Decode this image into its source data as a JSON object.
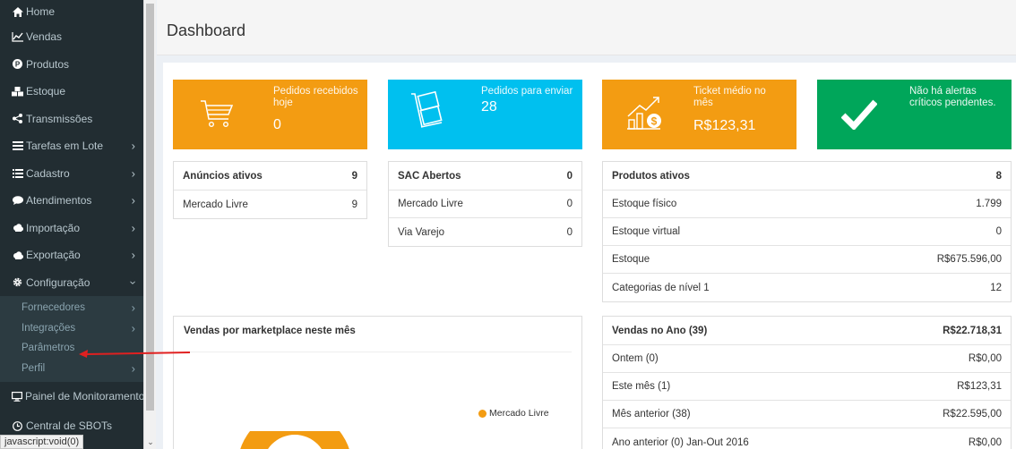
{
  "sidebar": {
    "items": [
      {
        "label": "Home"
      },
      {
        "label": "Vendas"
      },
      {
        "label": "Produtos"
      },
      {
        "label": "Estoque"
      },
      {
        "label": "Transmissões"
      },
      {
        "label": "Tarefas em Lote"
      },
      {
        "label": "Cadastro"
      },
      {
        "label": "Atendimentos"
      },
      {
        "label": "Importação"
      },
      {
        "label": "Exportação"
      },
      {
        "label": "Configuração"
      }
    ],
    "submenu": [
      {
        "label": "Fornecedores"
      },
      {
        "label": "Integrações"
      },
      {
        "label": "Parâmetros"
      },
      {
        "label": "Perfil"
      }
    ],
    "bottom_items": [
      {
        "label": "Painel de Monitoramento"
      },
      {
        "label": "Central de SBOTs"
      }
    ]
  },
  "status_bar": "javascript:void(0)",
  "header": {
    "title": "Dashboard"
  },
  "tiles": [
    {
      "label": "Pedidos recebidos hoje",
      "value": "0",
      "color": "#f39c12"
    },
    {
      "label": "Pedidos para enviar",
      "value": "28",
      "color": "#00c0ef"
    },
    {
      "label": "Ticket médio no mês",
      "value": "R$123,31",
      "color": "#f39c12"
    },
    {
      "label": "Não há alertas críticos pendentes.",
      "value": "",
      "color": "#00a65a"
    }
  ],
  "anuncios": {
    "title": "Anúncios ativos",
    "total": "9",
    "rows": [
      {
        "label": "Mercado Livre",
        "value": "9"
      }
    ]
  },
  "sac": {
    "title": "SAC Abertos",
    "total": "0",
    "rows": [
      {
        "label": "Mercado Livre",
        "value": "0"
      },
      {
        "label": "Via Varejo",
        "value": "0"
      }
    ]
  },
  "produtos": {
    "title": "Produtos ativos",
    "total": "8",
    "rows": [
      {
        "label": "Estoque físico",
        "value": "1.799"
      },
      {
        "label": "Estoque virtual",
        "value": "0"
      },
      {
        "label": "Estoque",
        "value": "R$675.596,00"
      },
      {
        "label": "Categorias de nível 1",
        "value": "12"
      }
    ]
  },
  "vendas_ano": {
    "title": "Vendas no Ano (39)",
    "total": "R$22.718,31",
    "rows": [
      {
        "label": "Ontem (0)",
        "value": "R$0,00"
      },
      {
        "label": "Este mês (1)",
        "value": "R$123,31"
      },
      {
        "label": "Mês anterior (38)",
        "value": "R$22.595,00"
      },
      {
        "label": "Ano anterior (0) Jan-Out 2016",
        "value": "R$0,00"
      }
    ]
  },
  "marketplace_chart": {
    "title": "Vendas por marketplace neste mês",
    "legend": [
      {
        "name": "Mercado Livre",
        "color": "#f39c12"
      }
    ]
  }
}
